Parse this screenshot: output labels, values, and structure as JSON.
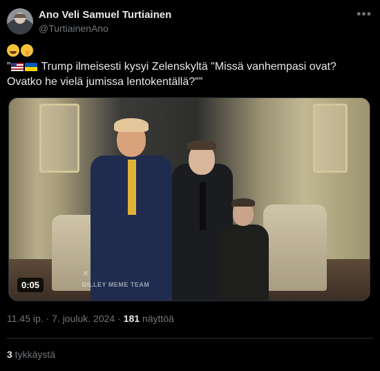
{
  "author": {
    "name": "Ano Veli Samuel Turtiainen",
    "handle": "@TurtiainenAno"
  },
  "tweet": {
    "emojis": [
      "laughing-tears-emoji",
      "shushing-face-emoji"
    ],
    "line1_prefix": "”",
    "flags": [
      "us-flag",
      "ukraine-flag"
    ],
    "line1_text": " Trump ilmeisesti kysyi Zelenskyltä \"Missä vanhempasi ovat?",
    "line2_text": "Ovatko he vielä jumissa lentokentällä?\"”"
  },
  "media": {
    "duration": "0:05",
    "watermark": "DILLEY MEME TEAM",
    "watermark_mark": "✕"
  },
  "meta": {
    "time": "11.45 ip.",
    "separator": " · ",
    "date": "7. jouluk. 2024",
    "views_count": "181",
    "views_label": " näyttöä"
  },
  "engagement": {
    "likes_count": "3",
    "likes_label": " tykkäystä"
  },
  "icons": {
    "more": "more-options-icon"
  },
  "colors": {
    "background": "#000000",
    "text": "#e7e9ea",
    "secondary": "#71767b",
    "border": "#2f3336"
  }
}
